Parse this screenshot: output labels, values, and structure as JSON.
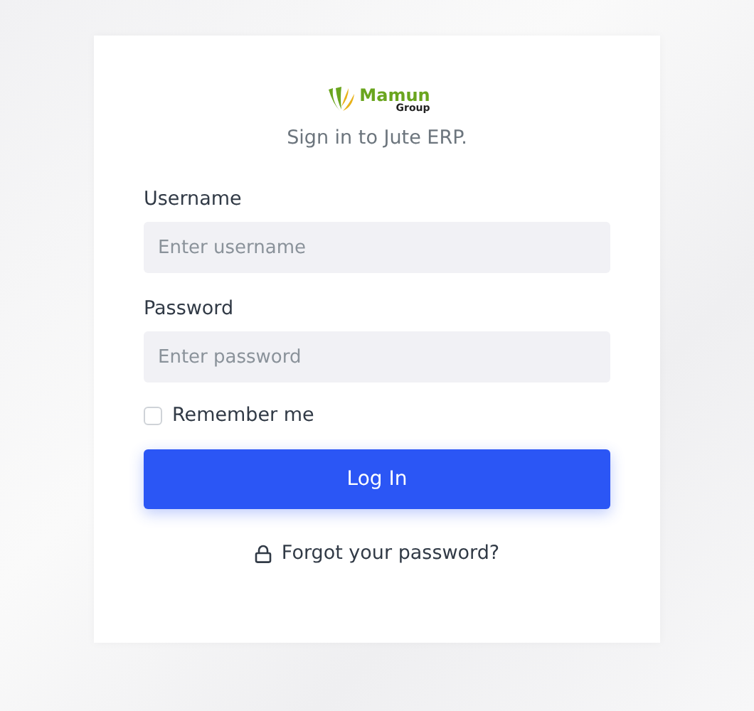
{
  "logo": {
    "name": "Mamun",
    "sub": "Group"
  },
  "subtitle": "Sign in to Jute ERP.",
  "fields": [
    {
      "label": "Username",
      "placeholder": "Enter username"
    },
    {
      "label": "Password",
      "placeholder": "Enter password"
    }
  ],
  "remember": {
    "label": "Remember me",
    "checked": false
  },
  "login_button": "Log In",
  "forgot_link": "Forgot your password?"
}
